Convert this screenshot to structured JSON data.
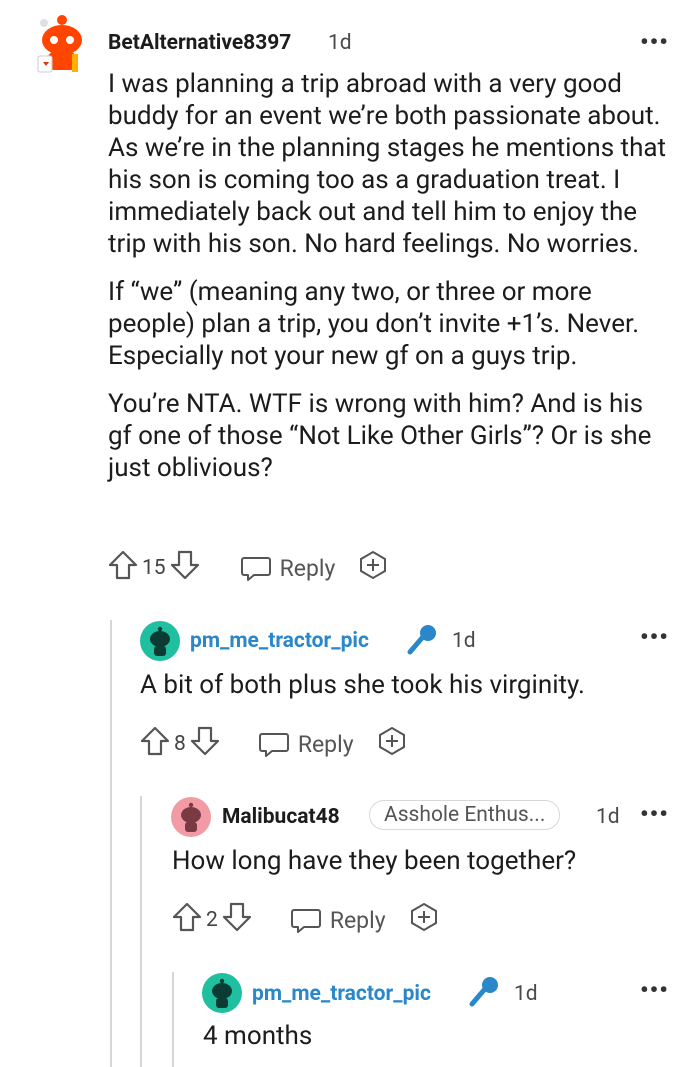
{
  "comment1": {
    "username": "BetAlternative8397",
    "time": "1d",
    "paragraphs": [
      "I was planning a trip abroad with a very good buddy for an event we’re both passionate about. As we’re in the planning stages he mentions that his son is coming too as a graduation treat. I immediately back out and tell him to enjoy the trip with his son. No hard feelings. No worries.",
      "If “we” (meaning any two, or three or more people) plan a trip, you don’t invite +1’s. Never. Especially not your new gf on a guys trip.",
      "You’re NTA. WTF is wrong with him? And is his gf one of those “Not Like Other Girls”? Or is she just oblivious?"
    ],
    "votes": "15",
    "reply_label": "Reply"
  },
  "comment2": {
    "username": "pm_me_tractor_pic",
    "time": "1d",
    "text": "A bit of both plus she took his virginity.",
    "votes": "8",
    "reply_label": "Reply"
  },
  "comment3": {
    "username": "Malibucat48",
    "flair": "Asshole Enthus...",
    "time": "1d",
    "text": "How long have they been together?",
    "votes": "2",
    "reply_label": "Reply"
  },
  "comment4": {
    "username": "pm_me_tractor_pic",
    "time": "1d",
    "text": "4 months"
  },
  "more_label": "•••",
  "colors": {
    "op_link": "#2a87c9",
    "avatar_red": "#ff4500",
    "avatar_teal": "#1fbf9f",
    "avatar_pink": "#f39ba4"
  }
}
